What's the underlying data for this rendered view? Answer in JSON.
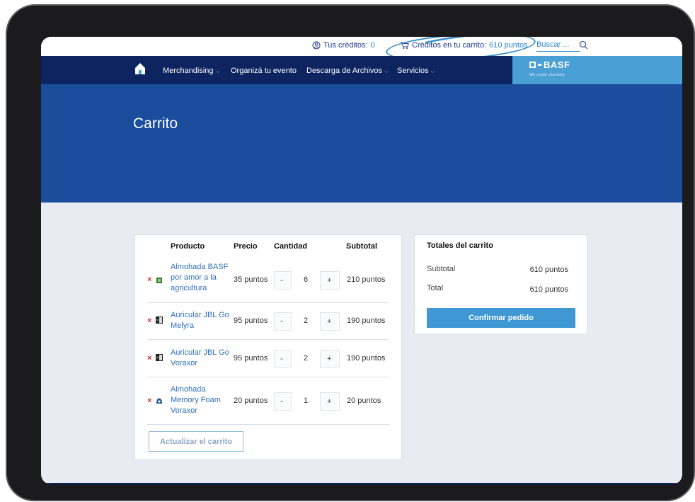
{
  "topbar": {
    "credits_label": "Tus créditos:",
    "credits_value": "0",
    "cart_label": "Créditos en tu carrito:",
    "cart_value": "610 puntos",
    "search_placeholder": "Buscar ..."
  },
  "nav": {
    "items": [
      {
        "label": "Merchandising",
        "has_dropdown": true
      },
      {
        "label": "Organizá tu evento",
        "has_dropdown": false
      },
      {
        "label": "Descarga de Archivos",
        "has_dropdown": true
      },
      {
        "label": "Servicios",
        "has_dropdown": true
      }
    ]
  },
  "brand": {
    "logo_text": "BASF",
    "tagline": "We create chemistry"
  },
  "hero": {
    "title": "Carrito"
  },
  "cart": {
    "headers": {
      "product": "Producto",
      "price": "Precio",
      "quantity": "Cantidad",
      "subtotal": "Subtotal"
    },
    "items": [
      {
        "name": "Almohada BASF por amor a la agricultura",
        "price": "35 puntos",
        "qty": "6",
        "subtotal": "210 puntos",
        "thumb": "green-box-icon"
      },
      {
        "name": "Auricular JBL Go Melyra",
        "price": "95 puntos",
        "qty": "2",
        "subtotal": "190 puntos",
        "thumb": "speaker-box-icon"
      },
      {
        "name": "Auricular JBL Go Voraxor",
        "price": "95 puntos",
        "qty": "2",
        "subtotal": "190 puntos",
        "thumb": "speaker-box-icon"
      },
      {
        "name": "Almohada Memory Foam Voraxor",
        "price": "20 puntos",
        "qty": "1",
        "subtotal": "20 puntos",
        "thumb": "pillow-icon"
      }
    ],
    "remove_symbol": "×",
    "minus": "-",
    "plus": "+",
    "update_label": "Actualizar el carrito"
  },
  "totals": {
    "title": "Totales del carrito",
    "subtotal_label": "Subtotal",
    "subtotal_value": "610 puntos",
    "total_label": "Total",
    "total_value": "610 puntos",
    "confirm_label": "Confirmar pedido"
  },
  "colors": {
    "navy": "#0d2461",
    "hero_blue": "#1a4d9c",
    "brand_blue": "#4a9fd4",
    "link_blue": "#2f6fb8",
    "remove_red": "#d0312d",
    "annotation_circle": "#3a8fc9"
  }
}
